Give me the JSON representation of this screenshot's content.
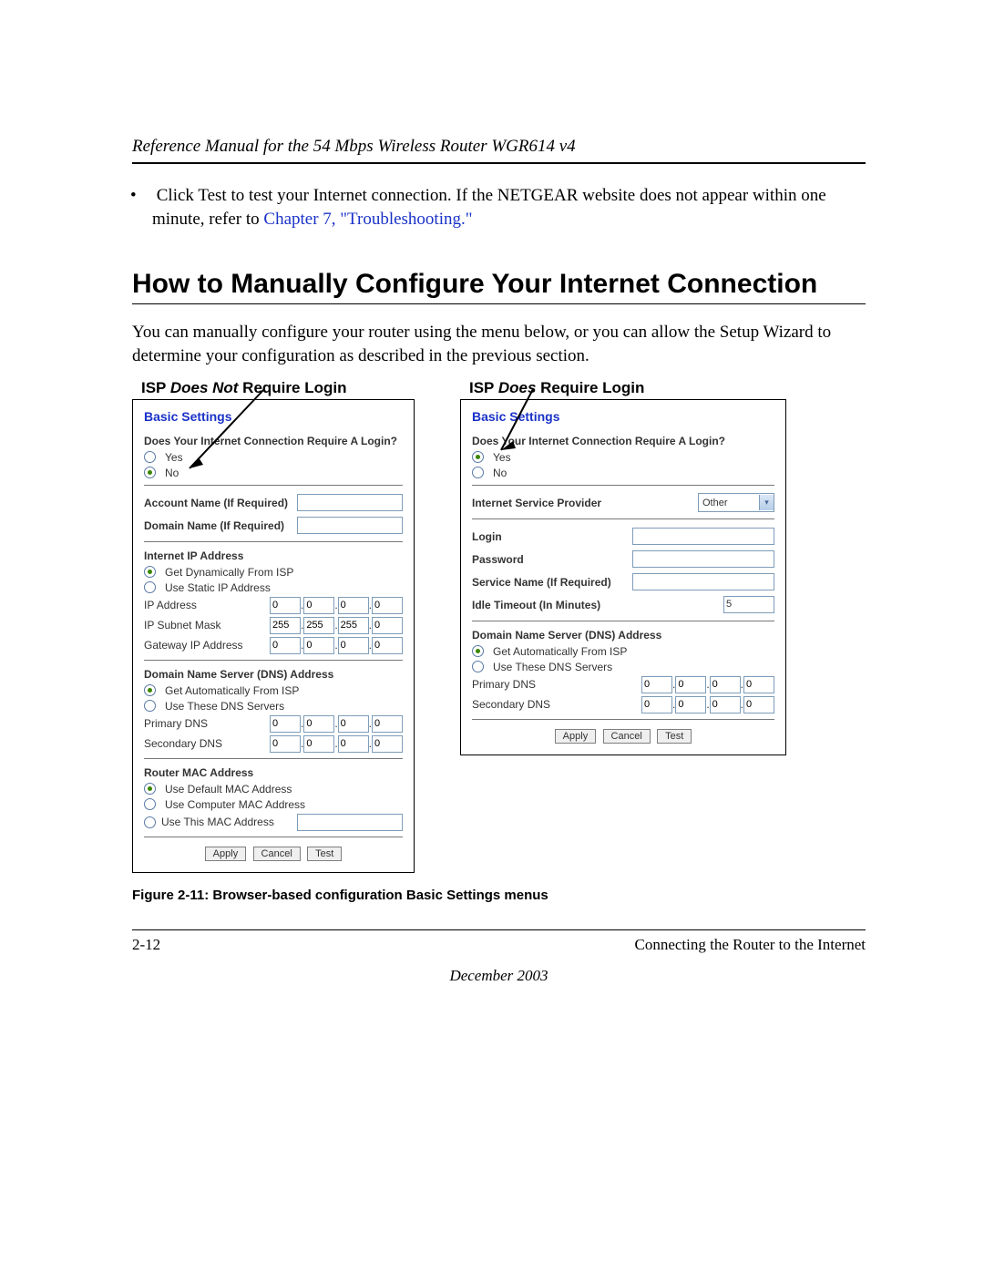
{
  "header": {
    "title": "Reference Manual for the 54 Mbps Wireless Router WGR614 v4"
  },
  "bullet": {
    "pre": "Click Test to test your Internet connection. If the NETGEAR website does not appear within one minute, refer to ",
    "link": "Chapter 7, \"Troubleshooting.\""
  },
  "section_heading": "How to Manually Configure Your Internet Connection",
  "intro": "You can manually configure your router using the menu below, or you can allow the Setup Wizard to determine your configuration as described in the previous section.",
  "col_labels": {
    "left_pre": "ISP ",
    "left_em": "Does Not",
    "left_post": " Require Login",
    "right_pre": "ISP ",
    "right_em": "Does",
    "right_post": " Require Login"
  },
  "panel_common": {
    "title": "Basic Settings",
    "login_q": "Does Your Internet Connection Require A Login?",
    "yes": "Yes",
    "no": "No",
    "apply": "Apply",
    "cancel": "Cancel",
    "test": "Test",
    "dns_head": "Domain Name Server (DNS) Address",
    "auto_isp": "Get Automatically From ISP",
    "use_dns": "Use These DNS Servers",
    "primary_dns": "Primary DNS",
    "secondary_dns": "Secondary DNS"
  },
  "left_panel": {
    "account_name": "Account Name (If Required)",
    "domain_name": "Domain Name (If Required)",
    "ip_head": "Internet IP Address",
    "dyn_isp": "Get Dynamically From ISP",
    "use_static": "Use Static IP Address",
    "ip_address": "IP Address",
    "subnet": "IP Subnet Mask",
    "gateway": "Gateway IP Address",
    "ip_vals": [
      "0",
      "0",
      "0",
      "0"
    ],
    "mask_vals": [
      "255",
      "255",
      "255",
      "0"
    ],
    "gw_vals": [
      "0",
      "0",
      "0",
      "0"
    ],
    "pdns": [
      "0",
      "0",
      "0",
      "0"
    ],
    "sdns": [
      "0",
      "0",
      "0",
      "0"
    ],
    "mac_head": "Router MAC Address",
    "mac_default": "Use Default MAC Address",
    "mac_comp": "Use Computer MAC Address",
    "mac_this": "Use This MAC Address"
  },
  "right_panel": {
    "isp_head": "Internet Service Provider",
    "isp_value": "Other",
    "login": "Login",
    "password": "Password",
    "service": "Service Name (If Required)",
    "idle": "Idle Timeout (In Minutes)",
    "idle_val": "5",
    "pdns": [
      "0",
      "0",
      "0",
      "0"
    ],
    "sdns": [
      "0",
      "0",
      "0",
      "0"
    ]
  },
  "figure_caption": "Figure 2-11:  Browser-based configuration Basic Settings menus",
  "footer": {
    "page_num": "2-12",
    "chapter": "Connecting the Router to the Internet",
    "date": "December 2003"
  }
}
